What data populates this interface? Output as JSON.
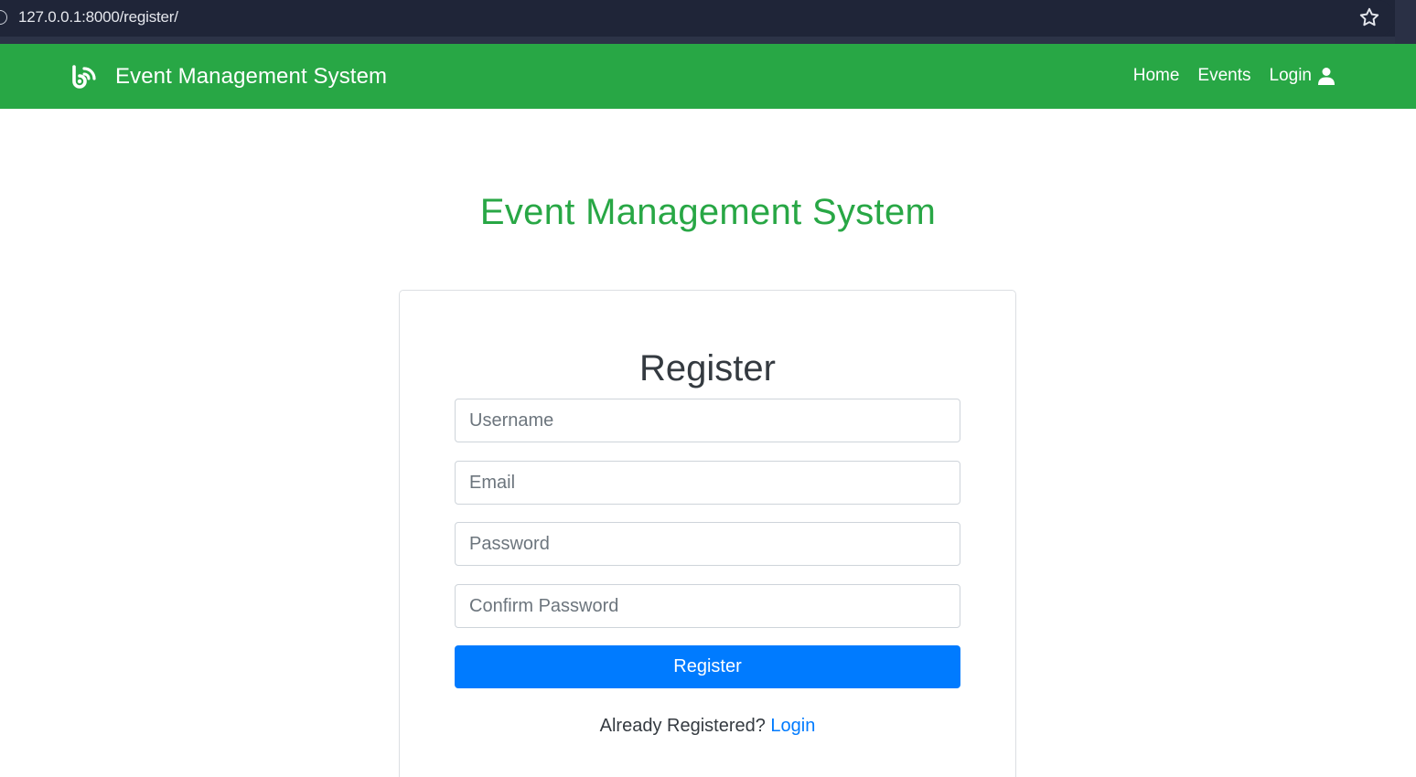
{
  "browser": {
    "url": "127.0.0.1:8000/register/",
    "bookmark_icon": "star-icon",
    "site_info_icon": "site-info-icon"
  },
  "navbar": {
    "brand_icon": "blogger-b-icon",
    "brand_text": "Event Management System",
    "links": [
      {
        "label": "Home"
      },
      {
        "label": "Events"
      },
      {
        "label": "Login",
        "icon": "user-icon"
      }
    ],
    "color": "#28a745"
  },
  "page": {
    "title": "Event Management System"
  },
  "form": {
    "title": "Register",
    "fields": {
      "username": {
        "placeholder": "Username",
        "value": ""
      },
      "email": {
        "placeholder": "Email",
        "value": ""
      },
      "password": {
        "placeholder": "Password",
        "value": ""
      },
      "confirm_password": {
        "placeholder": "Confirm Password",
        "value": ""
      }
    },
    "submit_label": "Register",
    "footer_text": "Already Registered?",
    "footer_link": "Login"
  },
  "colors": {
    "primary": "#007bff",
    "success": "#28a745",
    "browser_bg": "#1f2538"
  }
}
